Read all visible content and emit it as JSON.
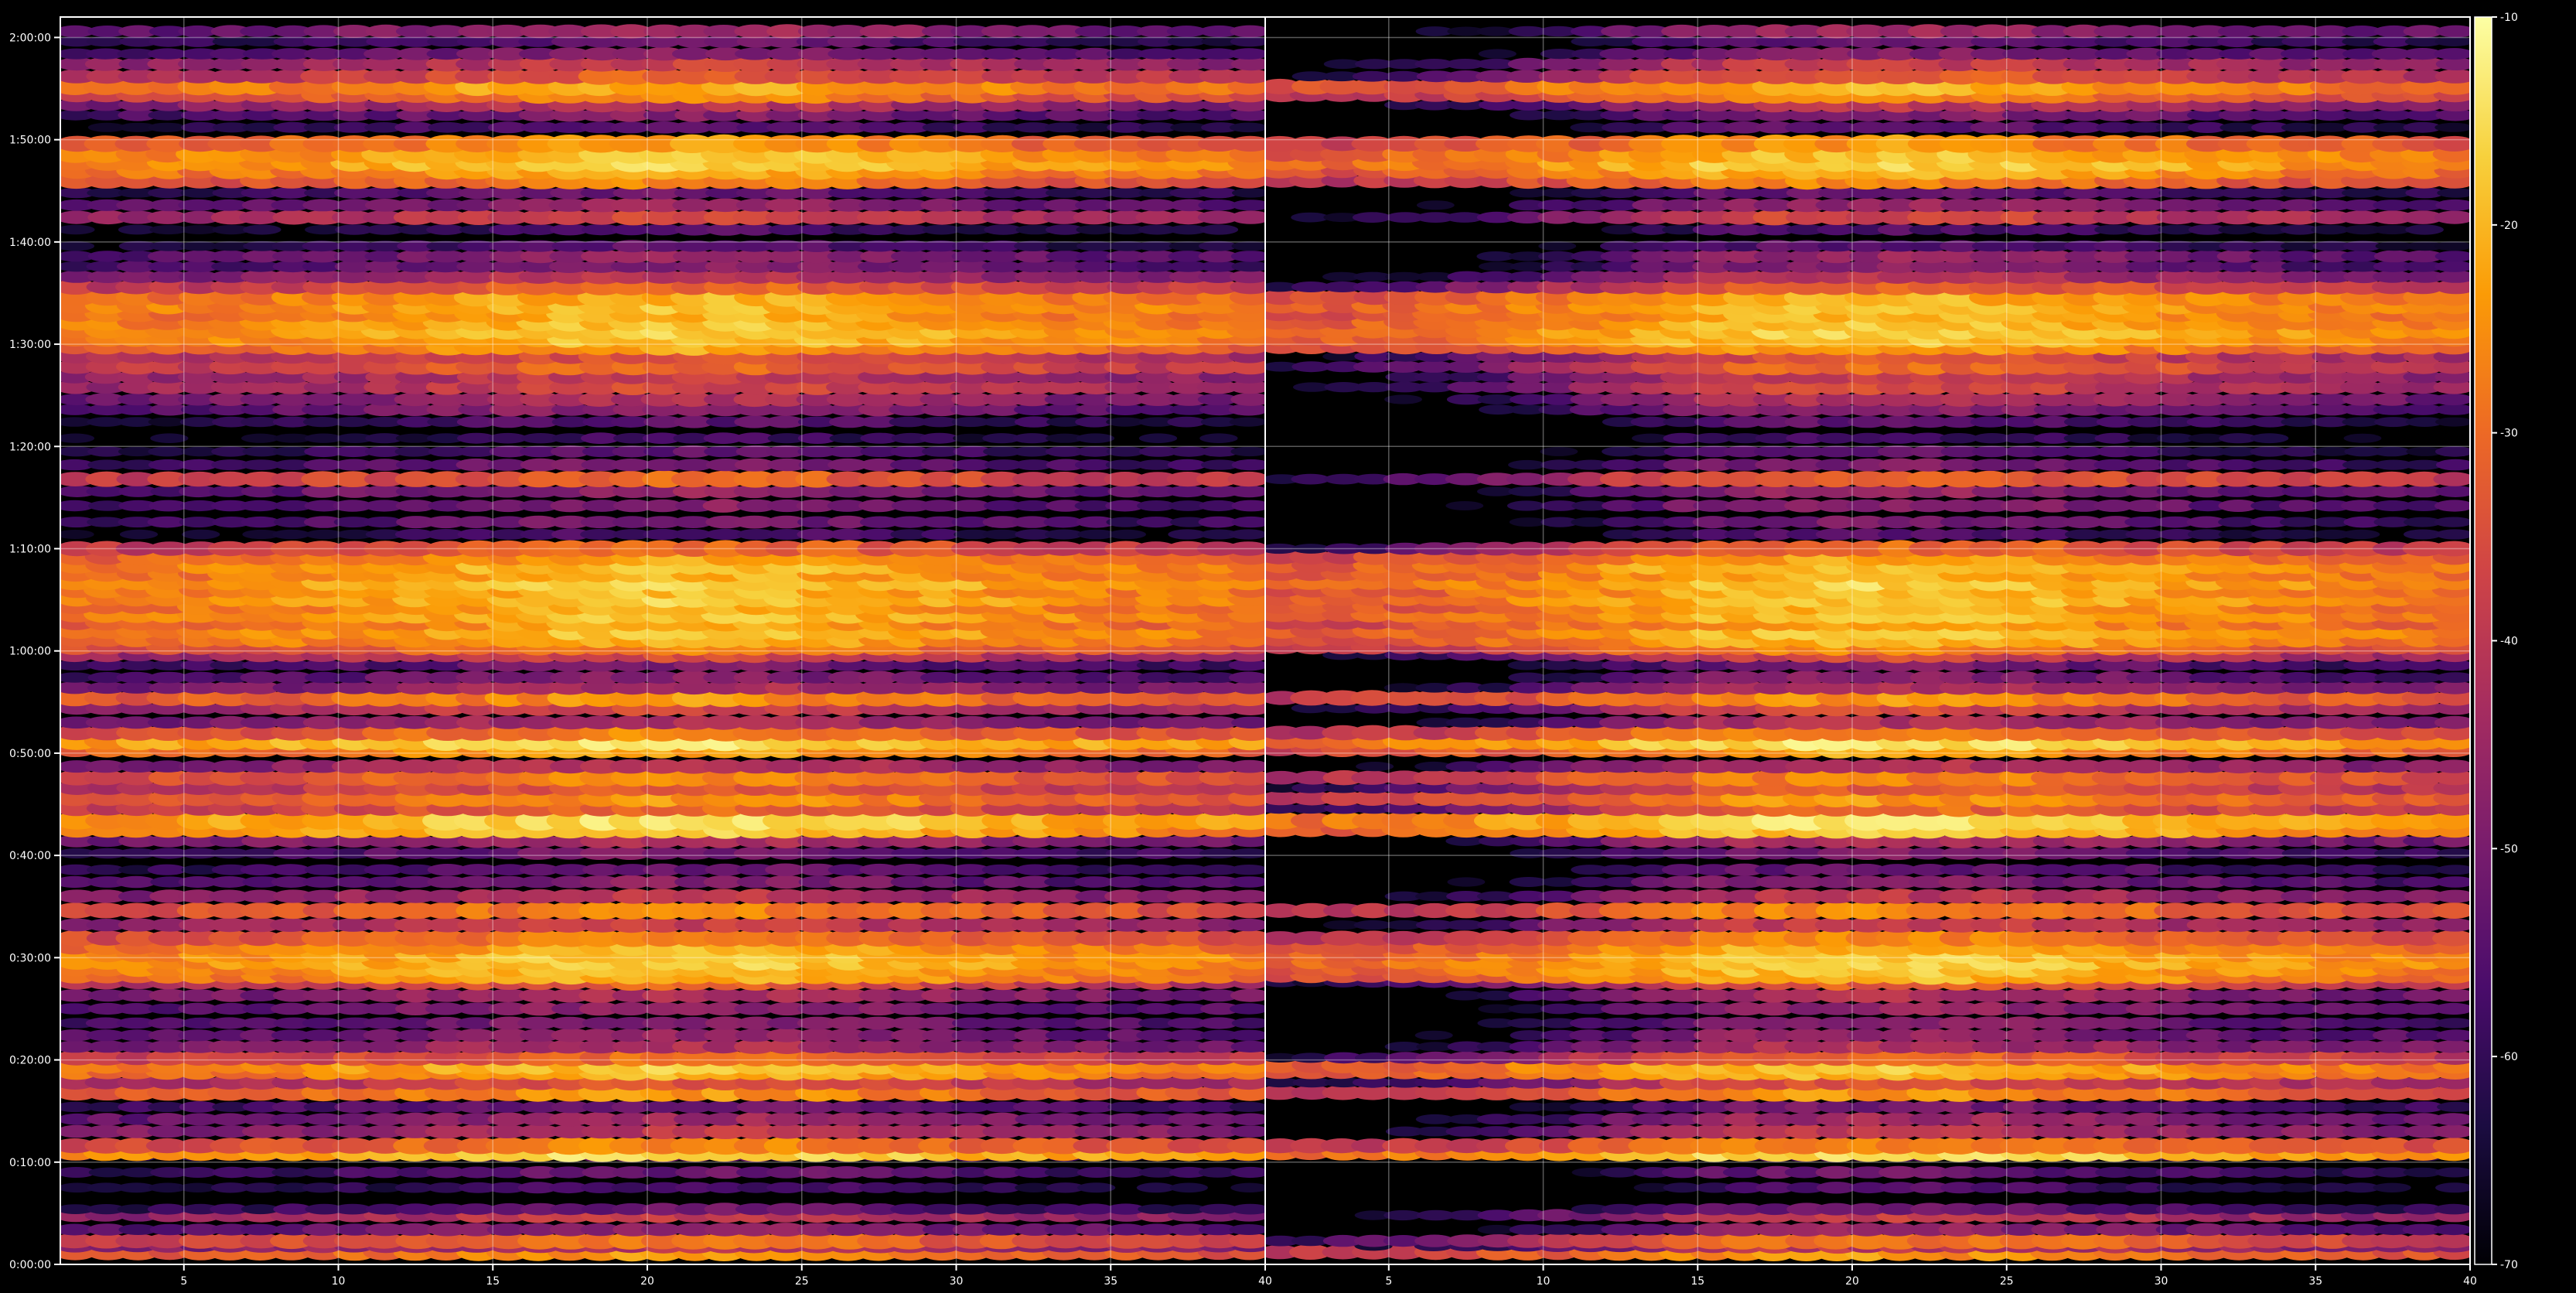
{
  "chart_data": {
    "type": "heatmap",
    "title": "",
    "xlabel": "",
    "ylabel": "",
    "background": "#000000",
    "grid": true,
    "colormap": "inferno",
    "colormap_stops": [
      "#000004",
      "#1b0c41",
      "#4a0c6b",
      "#781c6d",
      "#a52c60",
      "#cf4446",
      "#ed6925",
      "#fb9b06",
      "#f7d13d",
      "#fcffa4"
    ],
    "colorbar": {
      "min": -70,
      "max": -10,
      "ticks": [
        "-10",
        "-20",
        "-30",
        "-40",
        "-50",
        "-60",
        "-70"
      ]
    },
    "y_axis": {
      "range_minutes": [
        0,
        122
      ],
      "ticks": [
        "0:00:00",
        "0:10:00",
        "0:20:00",
        "0:30:00",
        "0:40:00",
        "0:50:00",
        "1:00:00",
        "1:10:00",
        "1:20:00",
        "1:30:00",
        "1:40:00",
        "1:50:00",
        "2:00:00"
      ]
    },
    "panels": [
      {
        "x_range": [
          1,
          40
        ],
        "x_ticks": [
          "5",
          "10",
          "15",
          "20",
          "25",
          "30",
          "35",
          "40"
        ],
        "data_x_range": [
          1.5,
          39.5
        ],
        "low_x_fade": 0
      },
      {
        "x_range": [
          1,
          40
        ],
        "x_ticks": [
          "5",
          "10",
          "15",
          "20",
          "25",
          "30",
          "35",
          "40"
        ],
        "data_x_range": [
          1.5,
          39.5
        ],
        "low_x_fade": 1
      }
    ],
    "rows": [
      {
        "t": 1.2,
        "v": -28
      },
      {
        "t": 1.8,
        "v": -44
      },
      {
        "t": 2.3,
        "v": -32
      },
      {
        "t": 3.4,
        "v": -50
      },
      {
        "t": 4.8,
        "v": -42
      },
      {
        "t": 5.4,
        "v": -56
      },
      {
        "t": 7.5,
        "v": -60
      },
      {
        "t": 9.0,
        "v": -56
      },
      {
        "t": 10.6,
        "v": -58
      },
      {
        "t": 11.0,
        "v": -18
      },
      {
        "t": 11.6,
        "v": -30
      },
      {
        "t": 13.0,
        "v": -44
      },
      {
        "t": 14.2,
        "v": -48
      },
      {
        "t": 15.4,
        "v": -54
      },
      {
        "t": 16.8,
        "v": -28
      },
      {
        "t": 17.8,
        "v": -38
      },
      {
        "t": 18.9,
        "v": -24
      },
      {
        "t": 19.5,
        "v": -22
      },
      {
        "t": 20.2,
        "v": -34
      },
      {
        "t": 21.3,
        "v": -46
      },
      {
        "t": 22.4,
        "v": -50
      },
      {
        "t": 23.6,
        "v": -52
      },
      {
        "t": 25.0,
        "v": -50
      },
      {
        "t": 26.3,
        "v": -46
      },
      {
        "t": 27.6,
        "v": -36
      },
      {
        "t": 28.3,
        "v": -24
      },
      {
        "t": 29.0,
        "v": -22
      },
      {
        "t": 29.7,
        "v": -20
      },
      {
        "t": 30.4,
        "v": -21
      },
      {
        "t": 31.1,
        "v": -24
      },
      {
        "t": 31.9,
        "v": -30
      },
      {
        "t": 33.2,
        "v": -42
      },
      {
        "t": 34.6,
        "v": -30
      },
      {
        "t": 36.0,
        "v": -44
      },
      {
        "t": 37.4,
        "v": -52
      },
      {
        "t": 38.6,
        "v": -56
      },
      {
        "t": 40.2,
        "v": -54
      },
      {
        "t": 41.4,
        "v": -46
      },
      {
        "t": 42.6,
        "v": -21
      },
      {
        "t": 43.4,
        "v": -18
      },
      {
        "t": 44.6,
        "v": -34
      },
      {
        "t": 45.6,
        "v": -28
      },
      {
        "t": 46.6,
        "v": -36
      },
      {
        "t": 47.6,
        "v": -30
      },
      {
        "t": 48.7,
        "v": -44
      },
      {
        "t": 50.4,
        "v": -26
      },
      {
        "t": 51.2,
        "v": -18
      },
      {
        "t": 52.0,
        "v": -30
      },
      {
        "t": 53.0,
        "v": -46
      },
      {
        "t": 54.4,
        "v": -40
      },
      {
        "t": 55.4,
        "v": -28
      },
      {
        "t": 56.4,
        "v": -46
      },
      {
        "t": 57.4,
        "v": -52
      },
      {
        "t": 58.6,
        "v": -54
      },
      {
        "t": 59.6,
        "v": -40
      },
      {
        "t": 60.4,
        "v": -30
      },
      {
        "t": 61.2,
        "v": -24
      },
      {
        "t": 62.0,
        "v": -22
      },
      {
        "t": 62.8,
        "v": -26
      },
      {
        "t": 63.6,
        "v": -22
      },
      {
        "t": 64.4,
        "v": -24
      },
      {
        "t": 65.2,
        "v": -21
      },
      {
        "t": 66.0,
        "v": -23
      },
      {
        "t": 66.8,
        "v": -20
      },
      {
        "t": 67.6,
        "v": -24
      },
      {
        "t": 68.4,
        "v": -22
      },
      {
        "t": 69.2,
        "v": -26
      },
      {
        "t": 70.0,
        "v": -34
      },
      {
        "t": 71.4,
        "v": -60
      },
      {
        "t": 72.6,
        "v": -54
      },
      {
        "t": 74.2,
        "v": -52
      },
      {
        "t": 75.6,
        "v": -50
      },
      {
        "t": 76.8,
        "v": -34
      },
      {
        "t": 78.2,
        "v": -54
      },
      {
        "t": 79.5,
        "v": -58
      },
      {
        "t": 80.8,
        "v": -62
      },
      {
        "t": 82.4,
        "v": -58
      },
      {
        "t": 83.6,
        "v": -50
      },
      {
        "t": 84.6,
        "v": -46
      },
      {
        "t": 85.8,
        "v": -40
      },
      {
        "t": 86.8,
        "v": -42
      },
      {
        "t": 87.8,
        "v": -34
      },
      {
        "t": 88.8,
        "v": -38
      },
      {
        "t": 89.8,
        "v": -26
      },
      {
        "t": 90.6,
        "v": -22
      },
      {
        "t": 91.4,
        "v": -20
      },
      {
        "t": 92.2,
        "v": -22
      },
      {
        "t": 93.0,
        "v": -24
      },
      {
        "t": 93.8,
        "v": -22
      },
      {
        "t": 94.6,
        "v": -24
      },
      {
        "t": 95.6,
        "v": -34
      },
      {
        "t": 96.6,
        "v": -44
      },
      {
        "t": 97.6,
        "v": -52
      },
      {
        "t": 98.6,
        "v": -50
      },
      {
        "t": 99.6,
        "v": -58
      },
      {
        "t": 101.2,
        "v": -60
      },
      {
        "t": 102.4,
        "v": -40
      },
      {
        "t": 103.6,
        "v": -50
      },
      {
        "t": 104.8,
        "v": -56
      },
      {
        "t": 106.0,
        "v": -30
      },
      {
        "t": 107.0,
        "v": -24
      },
      {
        "t": 107.8,
        "v": -20
      },
      {
        "t": 108.6,
        "v": -22
      },
      {
        "t": 109.6,
        "v": -28
      },
      {
        "t": 111.2,
        "v": -58
      },
      {
        "t": 112.4,
        "v": -52
      },
      {
        "t": 113.4,
        "v": -44
      },
      {
        "t": 114.4,
        "v": -30
      },
      {
        "t": 115.2,
        "v": -24
      },
      {
        "t": 116.2,
        "v": -36
      },
      {
        "t": 117.4,
        "v": -42
      },
      {
        "t": 118.4,
        "v": -52
      },
      {
        "t": 119.6,
        "v": -56
      },
      {
        "t": 120.6,
        "v": -48
      }
    ]
  }
}
